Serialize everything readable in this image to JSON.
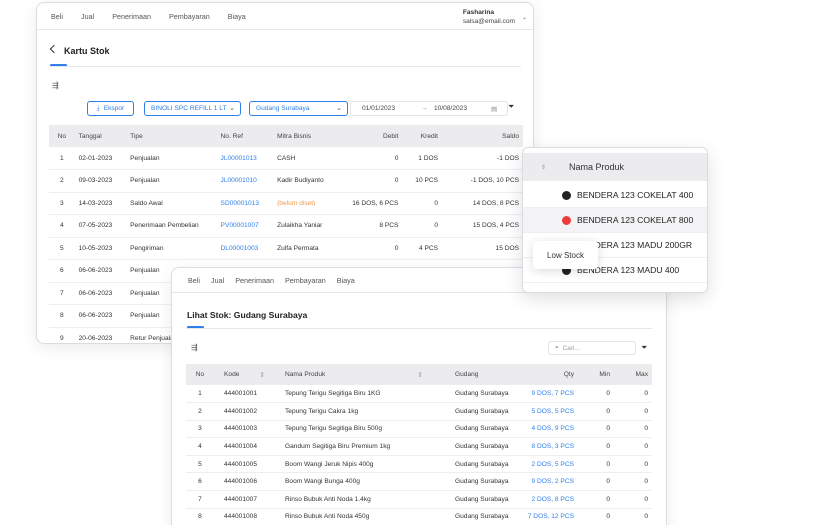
{
  "main": {
    "nav": [
      "Beli",
      "Jual",
      "Penerimaan",
      "Pembayaran",
      "Biaya"
    ],
    "user": {
      "name": "Fasharina",
      "email": "salsa@email.com"
    },
    "title": "Kartu Stok",
    "toolbar": {
      "export_label": "Ekspor",
      "product_select": "BINOLI SPC REFILL 1 LT",
      "warehouse_select": "Gudang Surabaya",
      "date_from": "01/01/2023",
      "date_arrow": "→",
      "date_to": "10/08/2023"
    },
    "table": {
      "headers": [
        "No",
        "Tanggal",
        "Tipe",
        "No. Ref",
        "Mitra Bisnis",
        "Debit",
        "Kredit",
        "Saldo"
      ],
      "rows": [
        {
          "no": "1",
          "tanggal": "02-01-2023",
          "tipe": "Penjualan",
          "ref": "JL00001013",
          "mitra": "CASH",
          "debit": "0",
          "kredit": "1 DOS",
          "saldo": "-1 DOS"
        },
        {
          "no": "2",
          "tanggal": "09-03-2023",
          "tipe": "Penjualan",
          "ref": "JL00001010",
          "mitra": "Kadir Budiyanto",
          "debit": "0",
          "kredit": "10 PCS",
          "saldo": "-1 DOS, 10 PCS"
        },
        {
          "no": "3",
          "tanggal": "14-03-2023",
          "tipe": "Saldo Awal",
          "ref": "SD00001013",
          "mitra": "(belum diset)",
          "debit": "16 DOS, 6 PCS",
          "kredit": "0",
          "saldo": "14 DOS, 8 PCS"
        },
        {
          "no": "4",
          "tanggal": "07-05-2023",
          "tipe": "Penerimaan Pembelian",
          "ref": "PV00001007",
          "mitra": "Zulaikha Yaniar",
          "debit": "8 PCS",
          "kredit": "0",
          "saldo": "15 DOS, 4 PCS"
        },
        {
          "no": "5",
          "tanggal": "10-05-2023",
          "tipe": "Pengiriman",
          "ref": "DL00001003",
          "mitra": "Zulfa Permata",
          "debit": "0",
          "kredit": "4 PCS",
          "saldo": "15 DOS"
        },
        {
          "no": "6",
          "tanggal": "06-06-2023",
          "tipe": "Penjualan",
          "ref": "",
          "mitra": "",
          "debit": "",
          "kredit": "",
          "saldo": ""
        },
        {
          "no": "7",
          "tanggal": "06-06-2023",
          "tipe": "Penjualan",
          "ref": "",
          "mitra": "",
          "debit": "",
          "kredit": "",
          "saldo": ""
        },
        {
          "no": "8",
          "tanggal": "06-06-2023",
          "tipe": "Penjualan",
          "ref": "",
          "mitra": "",
          "debit": "",
          "kredit": "",
          "saldo": ""
        },
        {
          "no": "9",
          "tanggal": "20-06-2023",
          "tipe": "Retur Penjualan",
          "ref": "",
          "mitra": "",
          "debit": "",
          "kredit": "",
          "saldo": ""
        }
      ]
    }
  },
  "stock": {
    "nav": [
      "Beli",
      "Jual",
      "Penerimaan",
      "Pembayaran",
      "Biaya"
    ],
    "title": "Lihat Stok: Gudang Surabaya",
    "search_placeholder": "Cari...",
    "table": {
      "headers": [
        "No",
        "Kode",
        "Nama Produk",
        "Gudang",
        "Qty",
        "Min",
        "Max"
      ],
      "rows": [
        {
          "no": "1",
          "kode": "444001001",
          "nama": "Tepung Terigu Segitiga Biru 1KG",
          "gudang": "Gudang Surabaya",
          "qty": "9 DOS, 7 PCS",
          "min": "0",
          "max": "0"
        },
        {
          "no": "2",
          "kode": "444001002",
          "nama": "Tepung Terigu Cakra 1kg",
          "gudang": "Gudang Surabaya",
          "qty": "5 DOS, 5 PCS",
          "min": "0",
          "max": "0"
        },
        {
          "no": "3",
          "kode": "444001003",
          "nama": "Tepung Terigu Segitiga Biru 500g",
          "gudang": "Gudang Surabaya",
          "qty": "4 DOS, 9 PCS",
          "min": "0",
          "max": "0"
        },
        {
          "no": "4",
          "kode": "444001004",
          "nama": "Gandum Segitiga Biru Premium 1kg",
          "gudang": "Gudang Surabaya",
          "qty": "8 DOS, 3 PCS",
          "min": "0",
          "max": "0"
        },
        {
          "no": "5",
          "kode": "444001005",
          "nama": "Boom Wangi Jeruk Nipis 400g",
          "gudang": "Gudang Surabaya",
          "qty": "2 DOS, 5 PCS",
          "min": "0",
          "max": "0"
        },
        {
          "no": "6",
          "kode": "444001006",
          "nama": "Boom Wangi Bunga 400g",
          "gudang": "Gudang Surabaya",
          "qty": "9 DOS, 2 PCS",
          "min": "0",
          "max": "0"
        },
        {
          "no": "7",
          "kode": "444001007",
          "nama": "Rinso Bubuk Anti Noda 1.4kg",
          "gudang": "Gudang Surabaya",
          "qty": "2 DOS, 8 PCS",
          "min": "0",
          "max": "0"
        },
        {
          "no": "8",
          "kode": "444001008",
          "nama": "Rinso Bubuk Anti Noda 450g",
          "gudang": "Gudang Surabaya",
          "qty": "7 DOS, 12 PCS",
          "min": "0",
          "max": "0"
        }
      ]
    }
  },
  "popup": {
    "header": "Nama Produk",
    "items": [
      {
        "name": "BENDERA 123 COKELAT 400",
        "status": "normal"
      },
      {
        "name": "BENDERA 123 COKELAT 800",
        "status": "low"
      },
      {
        "name": "BENDERA 123 MADU 200GR",
        "status": "normal"
      },
      {
        "name": "BENDERA 123 MADU 400",
        "status": "normal"
      }
    ],
    "tooltip": "Low Stock"
  },
  "colors": {
    "accent": "#2f80ed",
    "warning": "#f2994a",
    "low_stock": "#eb3b3b"
  }
}
